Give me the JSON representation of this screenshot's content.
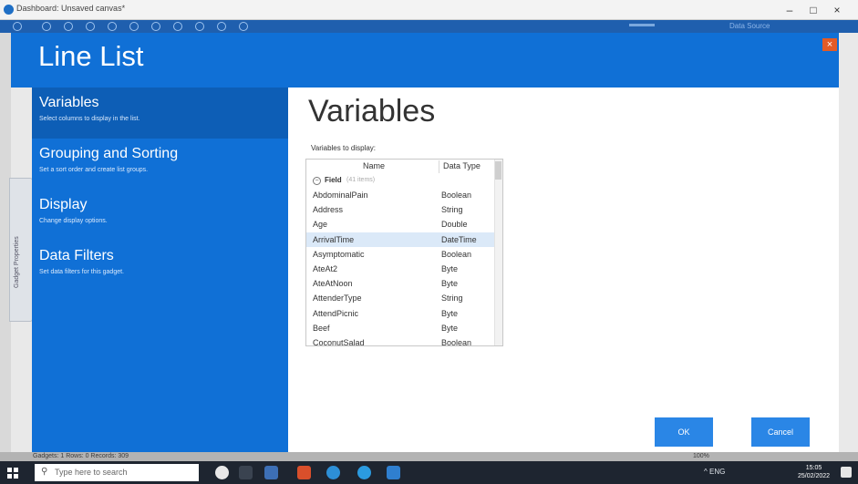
{
  "window": {
    "title": "Dashboard: Unsaved canvas*",
    "minimize_glyph": "–",
    "restore_glyph": "□",
    "close_glyph": "×"
  },
  "appbar": {
    "right_text": "Data Source"
  },
  "left_tab": {
    "label": "Gadget Properties"
  },
  "dialog": {
    "title": "Line List",
    "close_glyph": "×",
    "nav": [
      {
        "label": "Variables",
        "description": "Select columns to display in the list."
      },
      {
        "label": "Grouping and Sorting",
        "description": "Set a sort order and create list groups."
      },
      {
        "label": "Display",
        "description": "Change display options."
      },
      {
        "label": "Data Filters",
        "description": "Set data filters for this gadget."
      }
    ],
    "content": {
      "title": "Variables",
      "variables_label": "Variables to display:",
      "columns": {
        "name": "Name",
        "type": "Data Type"
      },
      "group": {
        "toggle": "−",
        "field": "Field",
        "sub": "(41 items)"
      },
      "rows": [
        {
          "name": "AbdominalPain",
          "type": "Boolean"
        },
        {
          "name": "Address",
          "type": "String"
        },
        {
          "name": "Age",
          "type": "Double"
        },
        {
          "name": "ArrivalTime",
          "type": "DateTime"
        },
        {
          "name": "Asymptomatic",
          "type": "Boolean"
        },
        {
          "name": "AteAt2",
          "type": "Byte"
        },
        {
          "name": "AteAtNoon",
          "type": "Byte"
        },
        {
          "name": "AttenderType",
          "type": "String"
        },
        {
          "name": "AttendPicnic",
          "type": "Byte"
        },
        {
          "name": "Beef",
          "type": "Byte"
        },
        {
          "name": "CoconutSalad",
          "type": "Boolean"
        }
      ],
      "selected_index": 3
    },
    "ok_label": "OK",
    "cancel_label": "Cancel"
  },
  "status": {
    "left": "Gadgets: 1   Rows: 0   Records: 309",
    "right": "100%"
  },
  "taskbar": {
    "search_placeholder": "Type here to search",
    "tray": "^  ENG",
    "time": "15:05",
    "date": "25/02/2022"
  },
  "colors": {
    "dialog_blue": "#1070d6",
    "active_nav": "#0d5eb6",
    "button_blue": "#2a86e6",
    "close_orange": "#e35b26",
    "selected_row": "#dbe9f8"
  }
}
